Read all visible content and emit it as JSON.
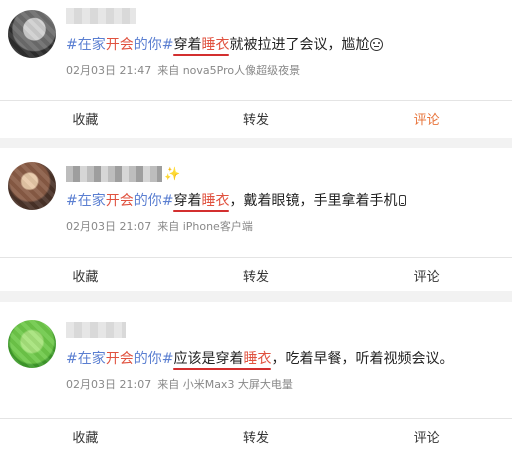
{
  "posts": [
    {
      "topic_prefix": "#在家",
      "topic_highlight": "开会",
      "topic_suffix": "的你#",
      "phrase_pre": "",
      "phrase_a": "穿着",
      "phrase_b": "睡衣",
      "body": "就被拉进了会议，尴尬",
      "emoji": "sweat-smile-icon",
      "time": "02月03日 21:47",
      "device": "来自 nova5Pro人像超级夜景",
      "actions": [
        "收藏",
        "转发",
        "评论"
      ],
      "active_action": 2
    },
    {
      "topic_prefix": "#在家",
      "topic_highlight": "开会",
      "topic_suffix": "的你#",
      "phrase_pre": "",
      "phrase_a": "穿着",
      "phrase_b": "睡衣",
      "body": "，戴着眼镜，手里拿着手机",
      "emoji": "phone-icon",
      "time": "02月03日 21:07",
      "device": "来自 iPhone客户端",
      "actions": [
        "收藏",
        "转发",
        "评论"
      ],
      "active_action": -1
    },
    {
      "topic_prefix": "#在家",
      "topic_highlight": "开会",
      "topic_suffix": "的你#",
      "phrase_pre": "应该是",
      "phrase_a": "穿着",
      "phrase_b": "睡衣",
      "body": "，吃着早餐，听着视频会议。",
      "emoji": "",
      "time": "02月03日 21:07",
      "device": "来自 小米Max3 大屏大电量",
      "actions": [
        "收藏",
        "转发",
        "评论"
      ],
      "active_action": -1
    }
  ],
  "badge_emoji": "✨",
  "colors": {
    "topic": "#5b7fd1",
    "highlight": "#e0523f",
    "active": "#e8743b",
    "underline": "#d32f2f"
  }
}
